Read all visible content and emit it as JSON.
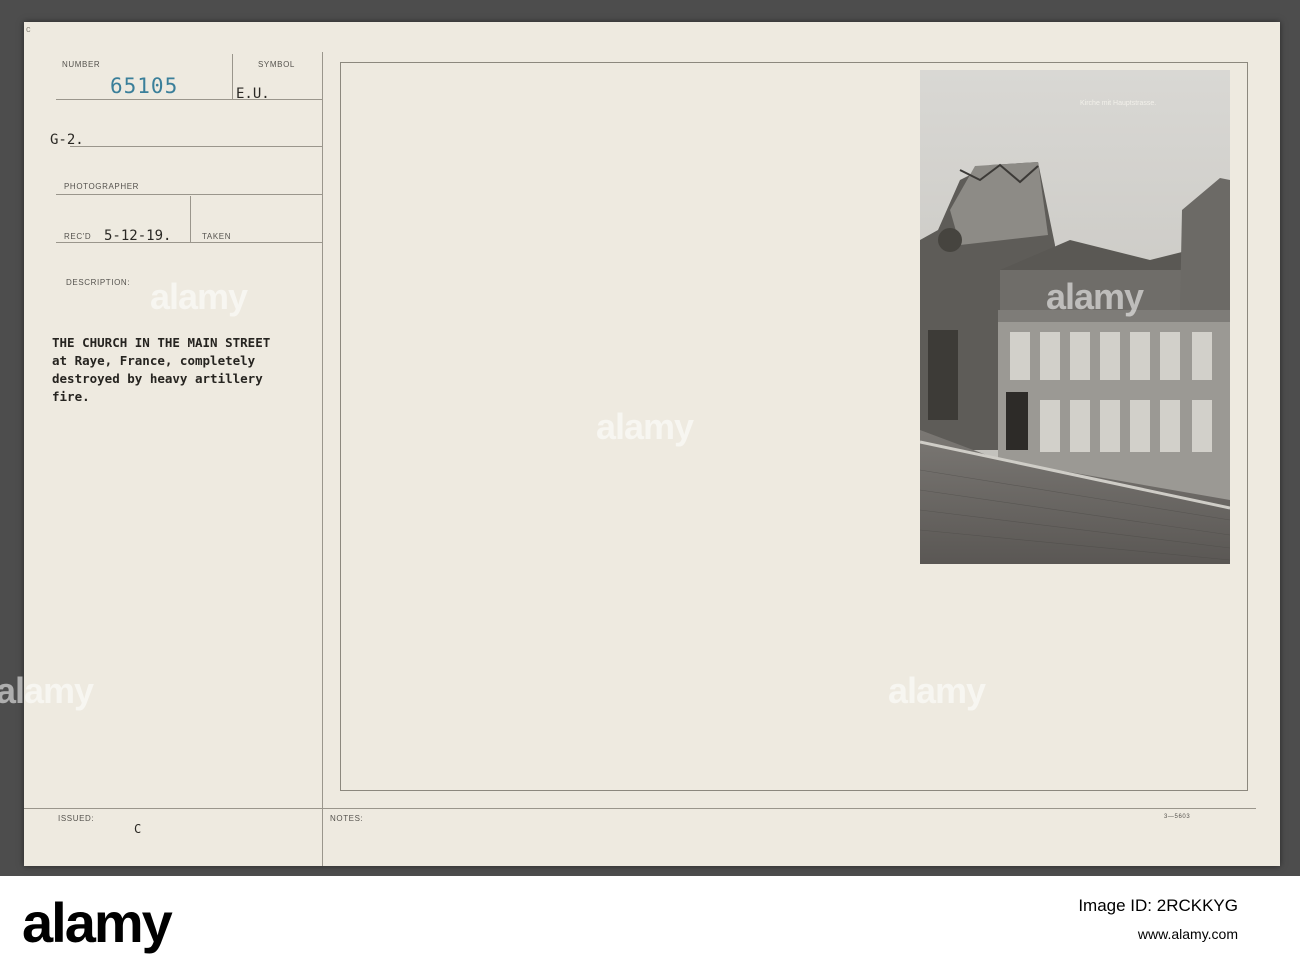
{
  "record": {
    "number_label": "NUMBER",
    "number": "65105",
    "symbol_label": "SYMBOL",
    "symbol": "E.U.",
    "unit": "G-2.",
    "photographer_label": "PHOTOGRAPHER",
    "recd_label": "REC'D",
    "recd": "5-12-19.",
    "taken_label": "TAKEN",
    "description_label": "DESCRIPTION:",
    "description": "THE CHURCH IN THE MAIN STREET\nat Raye, France, completely\ndestroyed by heavy artillery\nfire.",
    "issued_label": "ISSUED:",
    "issued": "C",
    "notes_label": "NOTES:",
    "form_code": "3—5603",
    "corner_mark": "c"
  },
  "photo": {
    "caption": "Kirche mit Hauptstrasse."
  },
  "watermark": {
    "text": "alamy"
  },
  "footer": {
    "logo": "alamy",
    "image_id": "Image ID: 2RCKKYG",
    "url": "www.alamy.com"
  }
}
